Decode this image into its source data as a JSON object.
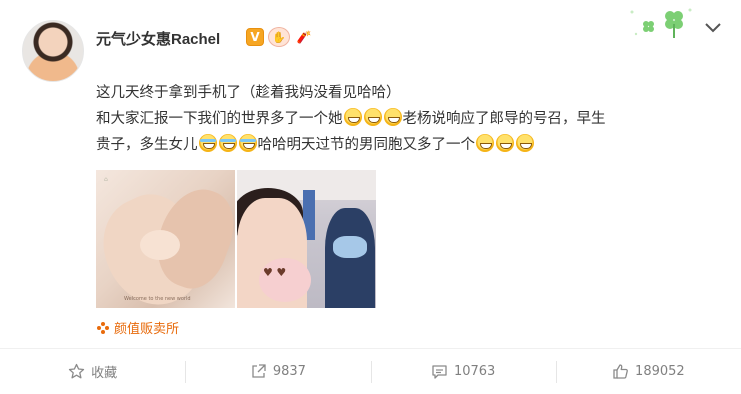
{
  "user": {
    "name": "元气少女惠Rachel",
    "verified_badge": "V",
    "badge_icons": [
      "v-verified-icon",
      "fan-hand-icon",
      "firecracker-icon"
    ]
  },
  "decorations": {
    "top_right_icon": "clover-icon",
    "menu_icon": "chevron-down-icon"
  },
  "post": {
    "line1": "这几天终于拿到手机了（趁着我妈没看见哈哈）",
    "line2_part1": "和大家汇报一下我们的世界多了一个她",
    "line2_part2": "老杨说响应了郎导的号召，早生",
    "line3_part1": "贵子，多生女儿",
    "line3_part2": "哈哈明天过节的男同胞又多了一个",
    "emoji_names": [
      "grin-icon",
      "cry-laugh-icon",
      "hee-hee-icon"
    ]
  },
  "photos": [
    {
      "name": "baby-hand-photo",
      "caption": "Welcome to the new world"
    },
    {
      "name": "hospital-family-photo"
    }
  ],
  "shop": {
    "label": "颜值贩卖所",
    "icon": "flower-icon",
    "color": "#e86b0c"
  },
  "actions": {
    "favorite_label": "收藏",
    "share_count": "9837",
    "comment_count": "10763",
    "like_count": "189052"
  }
}
